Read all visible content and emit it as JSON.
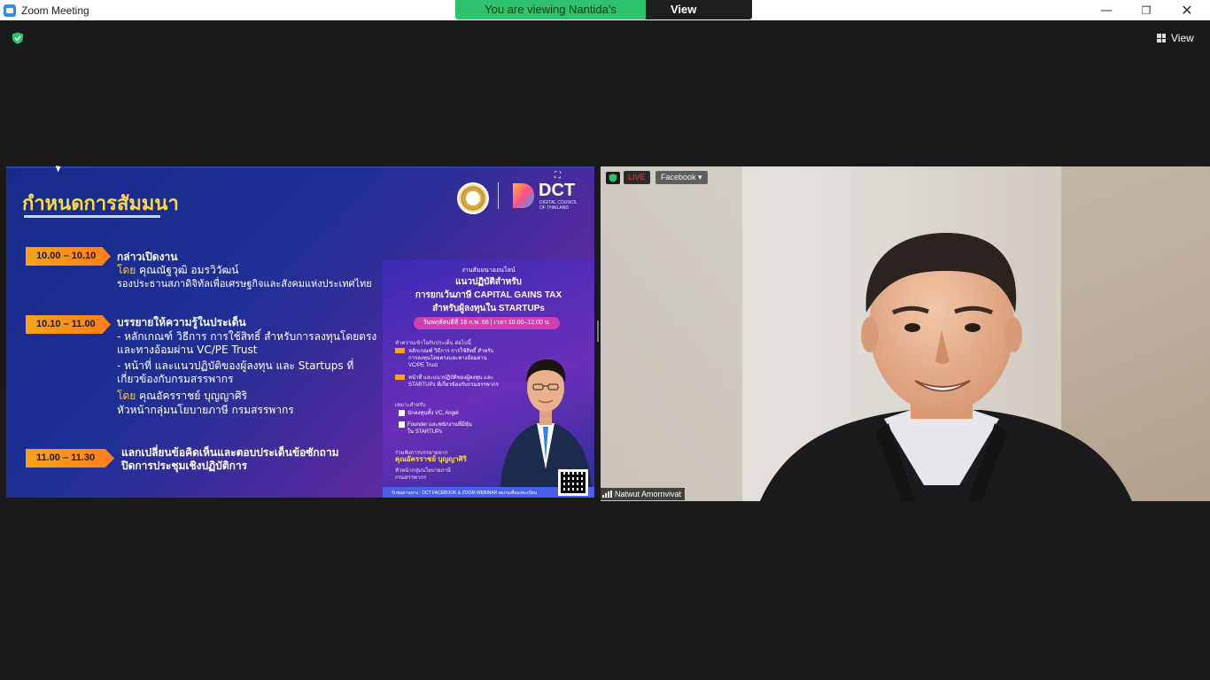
{
  "window": {
    "title": "Zoom Meeting",
    "minimize": "—",
    "maximize": "❐",
    "close": "✕"
  },
  "banner": {
    "viewing_text": "You are viewing Nantida's screen",
    "view_options_label": "View Options ⌄"
  },
  "toolbar": {
    "view_label": "View"
  },
  "shared_screen": {
    "title": "กำหนดการสัมมนา",
    "dct_logo_text": "DCT",
    "dct_logo_sub": [
      "DIGITAL COUNCIL",
      "OF THAILAND"
    ],
    "agenda": [
      {
        "time": "10.00 – 10.10",
        "lines": [
          {
            "text": "กล่าวเปิดงาน",
            "style": "strong"
          },
          {
            "by": "โดย",
            "text": " คุณณัฐวุฒิ อมรวิวัฒน์"
          },
          {
            "text": "รองประธานสภาดิจิทัลเพื่อเศรษฐกิจและสังคมแห่งประเทศไทย"
          }
        ]
      },
      {
        "time": "10.10 – 11.00",
        "lines": [
          {
            "text": "บรรยายให้ความรู้ในประเด็น",
            "style": "strong"
          },
          {
            "text": "-    หลักเกณฑ์ วิธีการ การใช้สิทธิ์ สำหรับการลงทุนโดยตรง"
          },
          {
            "text": "     และทางอ้อมผ่าน VC/PE Trust"
          },
          {
            "text": "-    หน้าที่ และแนวปฏิบัติของผู้ลงทุน และ Startups ที่"
          },
          {
            "text": "     เกี่ยวข้องกับกรมสรรพากร"
          },
          {
            "by": "โดย",
            "text": " คุณอัครราชย์ บุญญาศิริ"
          },
          {
            "text": "          หัวหน้ากลุ่มนโยบายภาษี    กรมสรรพากร"
          }
        ]
      },
      {
        "time": "11.00 – 11.30",
        "lines": [
          {
            "text": "แลกเปลี่ยนข้อคิดเห็นและตอบประเด็นข้อซักถาม",
            "style": "strong"
          },
          {
            "text": "ปิดการประชุมเชิงปฏิบัติการ",
            "style": "strong"
          }
        ]
      }
    ],
    "poster": {
      "kicker": "งานสัมมนาออนไลน์",
      "headline_1": "แนวปฏิบัติสำหรับ",
      "headline_2": "การยกเว้นภาษี CAPITAL GAINS TAX",
      "headline_3": "สำหรับผู้ลงทุนใน STARTUPs",
      "date_pill": "วันพฤหัสบดีที่ 16 ก.พ. 66  |  เวลา 10.00–12.00 น.",
      "topics_heading": "ทำความเข้าใจกับประเด็น ต่อไปนี้",
      "topic_1a": "หลักเกณฑ์ วิธีการ การใช้สิทธิ์ สำหรับ",
      "topic_1b": "การลงทุนโดยตรงและทางอ้อมผ่าน",
      "topic_1c": "VC/PE Trust",
      "topic_2a": "หน้าที่ และแนวปฏิบัติของผู้ลงทุน และ",
      "topic_2b": "STARTUPs  ที่เกี่ยวข้องกับกรมสรรพากร",
      "audience_heading": "เหมาะสำหรับ",
      "audience_1": "นักลงทุนทั้ง VC, Angel",
      "audience_2a": "Founder และพนักงานที่มีหุ้น",
      "audience_2b": "ใน STARTUPs",
      "speaker_intro": "ร่วมฟังการบรรยายจาก",
      "speaker_name": "คุณอัครราชย์  บุญญาศิริ",
      "speaker_role_1": "หัวหน้ากลุ่มนโยบายภาษี",
      "speaker_role_2": "กรมสรรพากร",
      "footer": "รับชมผ่านทาง : DCT FACEBOOK & ZOOM WEBINAR          สแกนเพื่อลงทะเบียน"
    }
  },
  "participant": {
    "name": "Natwut Amornvivat",
    "live_label": "LIVE",
    "stream_target": "Facebook ▾"
  },
  "colors": {
    "banner_green": "#2dc26b",
    "accent_orange": "#f5a319",
    "title_yellow": "#ffd84a",
    "security_green": "#2dc26b",
    "live_red": "#ff3131"
  },
  "icons": {
    "security": "shield-check-icon",
    "view": "grid-icon",
    "expand": "expand-icon"
  }
}
